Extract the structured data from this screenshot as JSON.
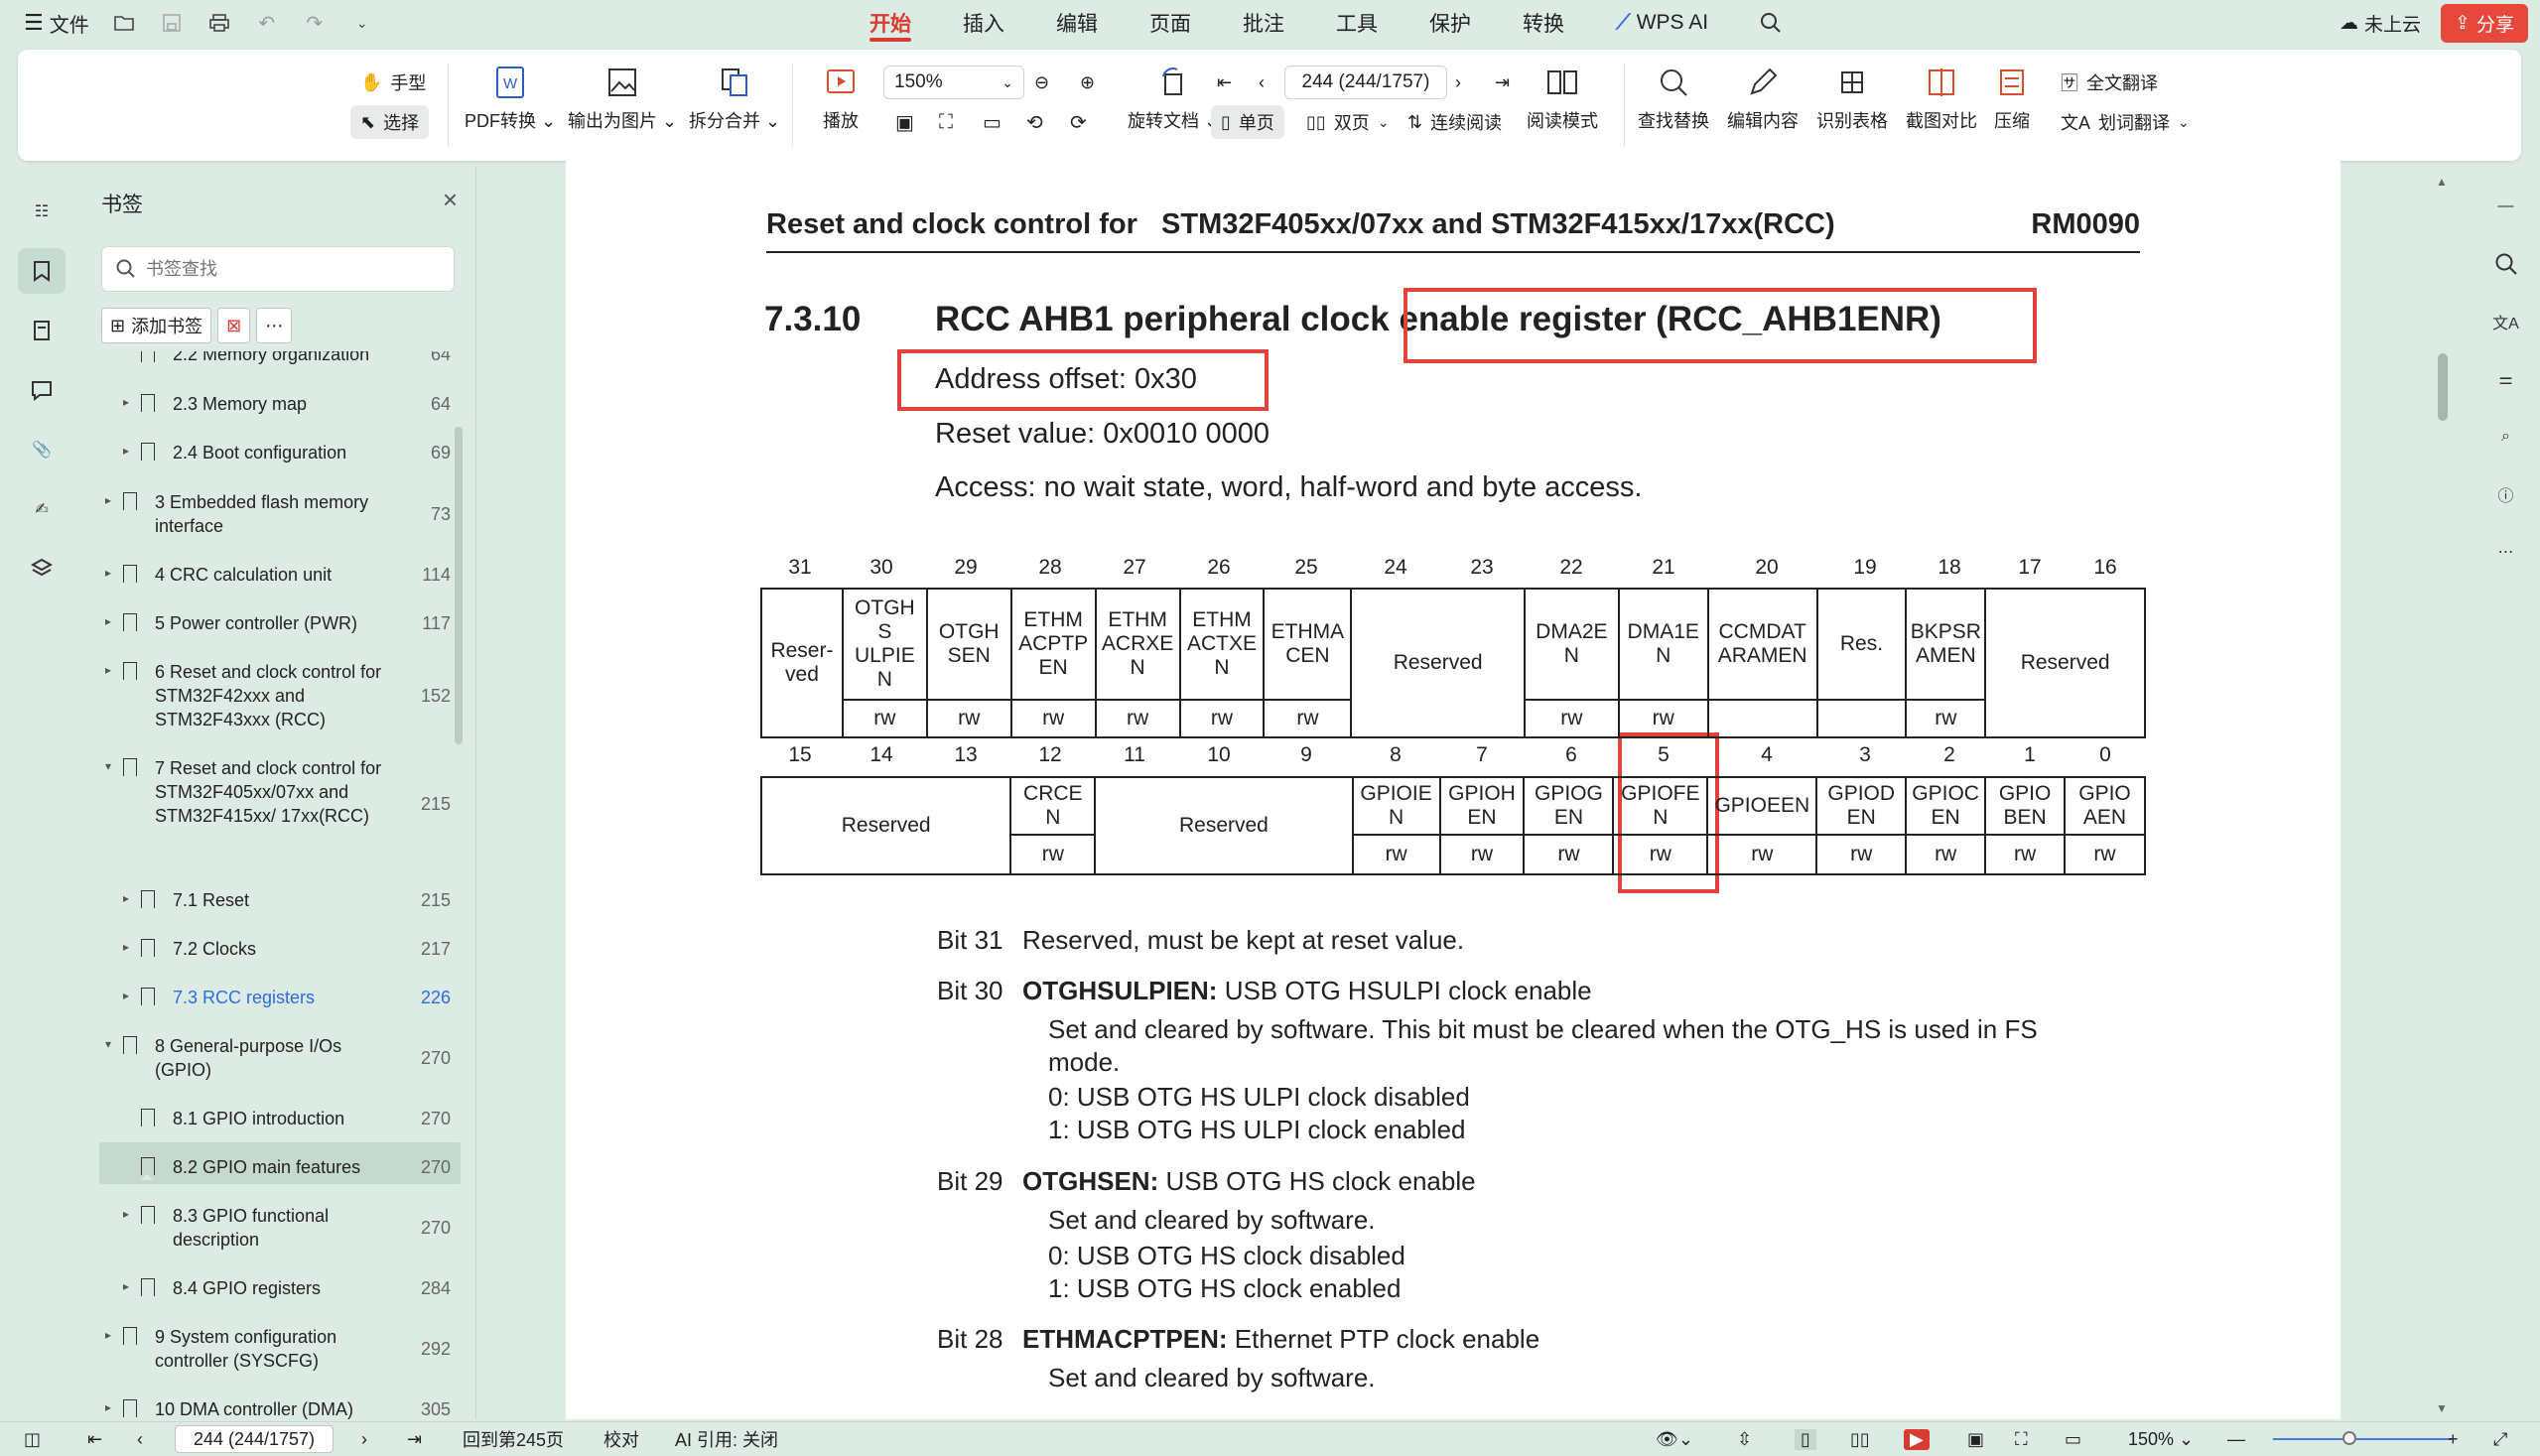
{
  "menubar": {
    "file_label": "文件",
    "tabs": [
      "开始",
      "插入",
      "编辑",
      "页面",
      "批注",
      "工具",
      "保护",
      "转换"
    ],
    "wps_ai_label": "WPS AI",
    "cloud_label": "未上云",
    "share_label": "分享"
  },
  "ribbon": {
    "hand_label": "手型",
    "select_label": "选择",
    "pdf_convert_label": "PDF转换",
    "export_image_label": "输出为图片",
    "split_merge_label": "拆分合并",
    "play_label": "播放",
    "zoom_value": "150%",
    "page_input": "244 (244/1757)",
    "rotate_label": "旋转文档",
    "single_page_label": "单页",
    "double_page_label": "双页",
    "continuous_label": "连续阅读",
    "read_mode_label": "阅读模式",
    "find_replace_label": "查找替换",
    "edit_content_label": "编辑内容",
    "recognize_table_label": "识别表格",
    "screenshot_compare_label": "截图对比",
    "compress_label": "压缩",
    "full_translate_label": "全文翻译",
    "word_translate_label": "划词翻译"
  },
  "bookmarks": {
    "title": "书签",
    "search_placeholder": "书签查找",
    "add_label": "添加书签",
    "items": [
      {
        "label": "2.2 Memory organization",
        "page": "64"
      },
      {
        "label": "2.3 Memory map",
        "page": "64"
      },
      {
        "label": "2.4 Boot configuration",
        "page": "69"
      },
      {
        "label": "3 Embedded flash memory interface",
        "page": "73"
      },
      {
        "label": "4 CRC calculation unit",
        "page": "114"
      },
      {
        "label": "5 Power controller (PWR)",
        "page": "117"
      },
      {
        "label": "6 Reset and clock control for STM32F42xxx and STM32F43xxx (RCC)",
        "page": "152"
      },
      {
        "label": "7 Reset and clock control for STM32F405xx/07xx and STM32F415xx/ 17xx(RCC)",
        "page": "215"
      },
      {
        "label": "7.1 Reset",
        "page": "215"
      },
      {
        "label": "7.2 Clocks",
        "page": "217"
      },
      {
        "label": "7.3 RCC registers",
        "page": "226"
      },
      {
        "label": "8 General-purpose I/Os (GPIO)",
        "page": "270"
      },
      {
        "label": "8.1 GPIO introduction",
        "page": "270"
      },
      {
        "label": "8.2 GPIO main features",
        "page": "270"
      },
      {
        "label": "8.3 GPIO functional description",
        "page": "270"
      },
      {
        "label": "8.4 GPIO registers",
        "page": "284"
      },
      {
        "label": "9 System configuration controller (SYSCFG)",
        "page": "292"
      },
      {
        "label": "10 DMA controller (DMA)",
        "page": "305"
      }
    ]
  },
  "document": {
    "header_left": "Reset and clock control for",
    "header_mid": "STM32F405xx/07xx and STM32F415xx/17xx(RCC)",
    "header_right": "RM0090",
    "section_number": "7.3.10",
    "section_title": "RCC AHB1 peripheral clock enable register (RCC_AHB1ENR)",
    "address_offset": "Address offset: 0x30",
    "reset_value": "Reset value: 0x0010 0000",
    "access": "Access: no wait state, word, half-word and byte access.",
    "high_bits": [
      "31",
      "30",
      "29",
      "28",
      "27",
      "26",
      "25",
      "24",
      "23",
      "22",
      "21",
      "20",
      "19",
      "18",
      "17",
      "16"
    ],
    "low_bits": [
      "15",
      "14",
      "13",
      "12",
      "11",
      "10",
      "9",
      "8",
      "7",
      "6",
      "5",
      "4",
      "3",
      "2",
      "1",
      "0"
    ],
    "high_fields": [
      "Reser-ved",
      "OTGHS ULPIEN",
      "OTGHSEN",
      "ETHMACPTPEN",
      "ETHMACRXEN",
      "ETHMACTXEN",
      "ETHMACEN",
      "Reserved",
      "DMA2EN",
      "DMA1EN",
      "CCMDATARAMEN",
      "Res.",
      "BKPSRAMEN",
      "Reserved"
    ],
    "low_fields": [
      "Reserved",
      "CRCEN",
      "Reserved",
      "GPIOIEN",
      "GPIOHEN",
      "GPIOGEN",
      "GPIOFEN",
      "GPIOEEN",
      "GPIODEN",
      "GPIOCEN",
      "GPIOBEN",
      "GPIOAEN"
    ],
    "rw": "rw",
    "bit31": "Bit 31",
    "bit31_text": "Reserved, must be kept at reset value.",
    "bit30": "Bit 30",
    "bit30_name": "OTGHSULPIEN:",
    "bit30_title": "USB OTG HSULPI clock enable",
    "bit30_l1": "Set and cleared by software. This bit must be cleared when the OTG_HS is used in FS",
    "bit30_l2": "mode.",
    "bit30_l3": "0: USB OTG HS ULPI clock disabled",
    "bit30_l4": "1: USB OTG HS ULPI clock enabled",
    "bit29": "Bit 29",
    "bit29_name": "OTGHSEN:",
    "bit29_title": "USB OTG HS clock enable",
    "bit29_l1": "Set and cleared by software.",
    "bit29_l2": "0: USB OTG HS clock disabled",
    "bit29_l3": "1: USB OTG HS clock enabled",
    "bit28": "Bit 28",
    "bit28_name": "ETHMACPTPEN:",
    "bit28_title": "Ethernet PTP clock enable",
    "bit28_l1": "Set and cleared by software."
  },
  "statusbar": {
    "page_input": "244 (244/1757)",
    "back_label": "回到第245页",
    "proof_label": "校对",
    "ai_ref_label": "AI 引用: 关闭",
    "zoom_value": "150%"
  },
  "colors": {
    "accent": "#d93b30",
    "highlight_box": "#e2423c",
    "active_bookmark": "#2f6be5"
  }
}
